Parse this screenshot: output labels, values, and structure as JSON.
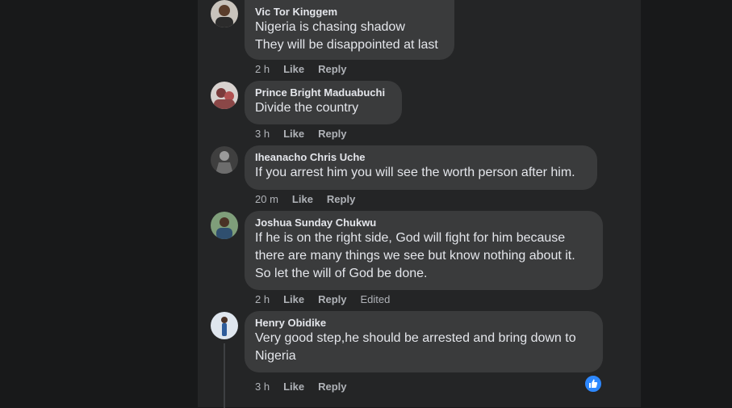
{
  "comments": [
    {
      "author": "Vic Tor Kinggem",
      "lines": "Nigeria is chasing shadow\nThey will be disappointed at last",
      "time": "2 h",
      "like": "Like",
      "reply": "Reply"
    },
    {
      "author": "Prince Bright Maduabuchi",
      "lines": "Divide the country",
      "time": "3 h",
      "like": "Like",
      "reply": "Reply"
    },
    {
      "author": "Iheanacho Chris Uche",
      "lines": "If you arrest him you will see the worth person after him.",
      "time": "20 m",
      "like": "Like",
      "reply": "Reply"
    },
    {
      "author": "Joshua Sunday Chukwu",
      "lines": "If he is on the right side, God will fight for him because\nthere are many things we see but know nothing about it.\nSo let the will of God be done.",
      "time": "2 h",
      "like": "Like",
      "reply": "Reply",
      "edited": "Edited"
    },
    {
      "author": "Henry Obidike",
      "lines": "Very good step,he should be arrested and bring down to\nNigeria",
      "time": "3 h",
      "like": "Like",
      "reply": "Reply"
    }
  ],
  "colors": {
    "page_bg": "#18191a",
    "card_bg": "#242526",
    "bubble_bg": "#3a3b3c",
    "text_primary": "#e4e6eb",
    "text_secondary": "#b0b3b8",
    "like_blue": "#2d88ff"
  },
  "icons": {
    "reaction": "thumbs-up-icon"
  }
}
